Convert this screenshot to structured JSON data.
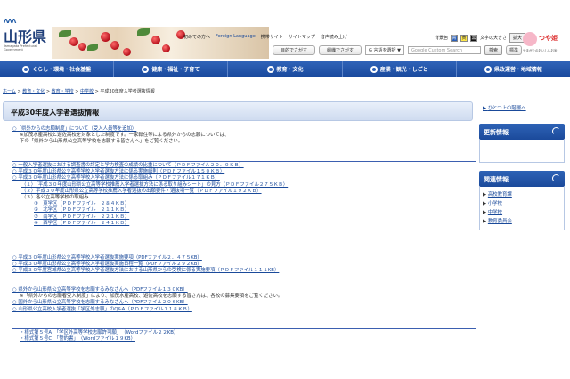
{
  "header": {
    "logo_mark": "ΛΛΛ",
    "logo_text": "山形県",
    "logo_sub": "Yamagata Prefectural Government",
    "top_links": [
      "初めての方へ",
      "Foreign Language",
      "携帯サイト",
      "サイトマップ",
      "音声読み上げ"
    ],
    "background_color_label": "背景色",
    "text_size_label": "文字の大きさ",
    "enlarge_button": "拡大",
    "standard_button": "標準",
    "swatches": [
      "青",
      "黄",
      "黒"
    ],
    "purpose_button": "目的でさがす",
    "org_button": "組織でさがす",
    "translate_label": "言語を選択",
    "search_placeholder": "Google Custom Search",
    "search_button": "検索",
    "mascot_name": "つや姫",
    "mascot_tag": "やまがたのおいしいお米"
  },
  "mainnav": [
    "くらし・環境・社会基盤",
    "健康・福祉・子育て",
    "教育・文化",
    "産業・観光・しごと",
    "県政運営・地域情報"
  ],
  "breadcrumb": {
    "items": [
      "ホーム",
      "教育・文化",
      "教育・学校",
      "中学校"
    ],
    "current": "平成30年度入学者選抜情報",
    "sep": " > "
  },
  "page_title": "平成30年度入学者選抜情報",
  "section1": {
    "link": "○「県外からの志願制度」について（受入人員等を追加）",
    "note1": "※加茂水産高校と遊佐高校を対象とした制度です。一家転住等による県外からの志願については、",
    "note2": "下の「県外から山形県公立高等学校を志願する皆さんへ」をご覧ください。"
  },
  "section2": [
    {
      "text": "○ 一般入学者選抜における調査書の評定と学力検査の成績の比重について（ＰＤＦファイル２０．０ＫＢ）",
      "type": "link"
    },
    {
      "text": "○ 平成３０年度山形県公立高等学校入学者選抜方法に係る実施細則（ＰＤＦファイル１５０ＫＢ）",
      "type": "link"
    },
    {
      "text": "○ 平成３０年度山形県公立高等学校入学者選抜方法に係る取組み（ＰＤＦファイル１７１ＫＢ）",
      "type": "link"
    },
    {
      "text": "（１）「平成３０年度山形県公立高等学校推薦入学者選抜方法に係る取り組みシート」の見方（ＰＤＦファイル２７５ＫＢ）",
      "type": "link",
      "indent": 1
    },
    {
      "text": "（２）平成３０年度山形県公立高等学校推薦入学者選抜の出願要件・選抜場一覧（ＰＤＦファイル１９２ＫＢ）",
      "type": "link",
      "indent": 1
    },
    {
      "text": "（３）各公立高等学校の取組み",
      "type": "text",
      "indent": 1
    },
    {
      "text": "①　東学区（ＰＤＦファイル　２８４ＫＢ）",
      "type": "link",
      "indent": 2
    },
    {
      "text": "②　北学区（ＰＤＦファイル　２１１ＫＢ）",
      "type": "link",
      "indent": 2
    },
    {
      "text": "③　南学区（ＰＤＦファイル　２２１ＫＢ）",
      "type": "link",
      "indent": 2
    },
    {
      "text": "④　西学区（ＰＤＦファイル　２４１ＫＢ）",
      "type": "link",
      "indent": 2
    }
  ],
  "section3": [
    "○ 平成３０年度山形県公立高等学校入学者選抜実施要項（PDFファイル２．４７５KB）",
    "○ 平成３０年度山形県公立高等学校入学者選抜実施日程一覧（PDFファイル２９２KB）",
    "○ 平成３０年度宮城県公立高等学校入学者選抜方法における山形県からの受検に係る実施要項（ＰＤＦファイル１１１KB）"
  ],
  "section4": {
    "link1": "○ 県外から山形県公立高等学校を志願するみなさんへ（PDFファイル１３０KB）",
    "note": "※「県外からの志願者受入制度」により、加茂水産高校、遊佐高校を志願する皆さんは、各校の募集要項をご覧ください。",
    "link2": "○ 国外から山形県公立高等学校を志願するみなさんへ（PDFファイル２０６KB）",
    "link3": "○ 山形県公立高校入学者選抜「学区外志願」のQ&A（ＰＤＦファイル１１８ＫＢ）"
  },
  "section5": [
    "・様式第５号A　「学区外高等学校志願許可願」　（Wordファイル２２KB）",
    "・様式第５号C　「誓約書」　（Wordファイル１９KB）"
  ],
  "sidebar": {
    "up_link": "ひとつ上の階層へ",
    "news_head": "更新情報",
    "related_head": "関連情報",
    "related_items": [
      "高校教育課",
      "小学校",
      "中学校",
      "教育委員会"
    ]
  },
  "colors": {
    "nav_blue": "#1a4a9e",
    "link_blue": "#1a4a9a",
    "title_bg": "#dde7f6"
  }
}
